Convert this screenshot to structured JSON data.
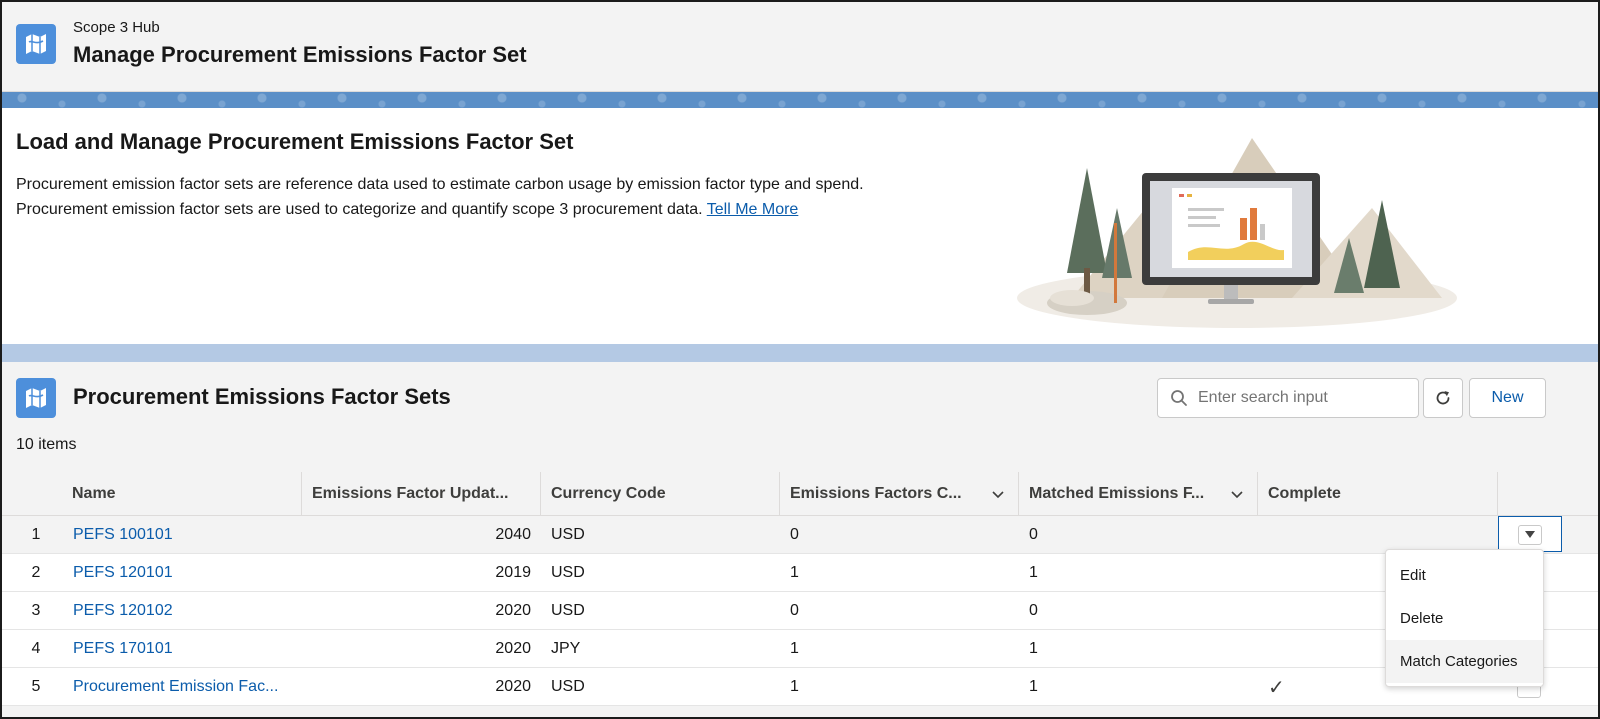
{
  "header": {
    "crumb": "Scope 3 Hub",
    "title": "Manage Procurement Emissions Factor Set",
    "icon": "map-icon"
  },
  "intro": {
    "heading": "Load and Manage Procurement Emissions Factor Set",
    "description": "Procurement emission factor sets are reference data used to estimate carbon usage by emission factor type and spend. Procurement emission factor sets are used to categorize and quantify scope 3 procurement data.",
    "link_label": "Tell Me More"
  },
  "list": {
    "title": "Procurement Emissions Factor Sets",
    "count": "10 items",
    "search_placeholder": "Enter search input",
    "new_label": "New",
    "columns": [
      "Name",
      "Emissions Factor Updat...",
      "Currency Code",
      "Emissions Factors C...",
      "Matched Emissions F...",
      "Complete"
    ],
    "rows": [
      {
        "index": "1",
        "name": "PEFS 100101",
        "year": "2040",
        "currency": "USD",
        "factors": "0",
        "matched": "0",
        "complete": ""
      },
      {
        "index": "2",
        "name": "PEFS 120101",
        "year": "2019",
        "currency": "USD",
        "factors": "1",
        "matched": "1",
        "complete": ""
      },
      {
        "index": "3",
        "name": "PEFS 120102",
        "year": "2020",
        "currency": "USD",
        "factors": "0",
        "matched": "0",
        "complete": ""
      },
      {
        "index": "4",
        "name": "PEFS 170101",
        "year": "2020",
        "currency": "JPY",
        "factors": "1",
        "matched": "1",
        "complete": ""
      },
      {
        "index": "5",
        "name": "Procurement Emission Fac...",
        "year": "2020",
        "currency": "USD",
        "factors": "1",
        "matched": "1",
        "complete": "✓"
      }
    ]
  },
  "menu": {
    "items": [
      "Edit",
      "Delete",
      "Match Categories"
    ]
  },
  "colors": {
    "brand": "#4d8fdb",
    "link": "#0b5cab",
    "strip": "#5b8fc7",
    "band": "#b4c9e4"
  }
}
